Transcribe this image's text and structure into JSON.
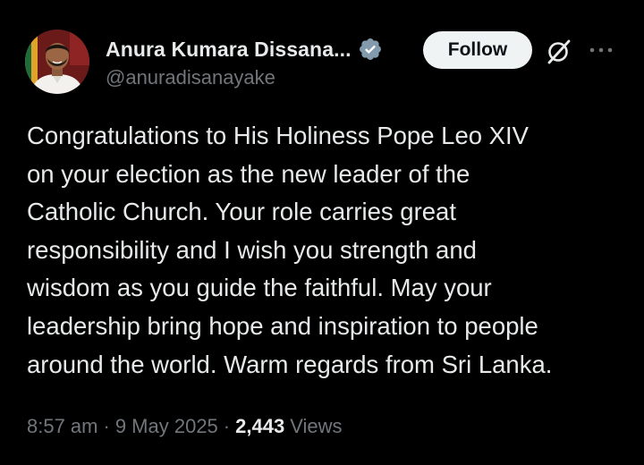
{
  "author": {
    "display_name": "Anura Kumara Dissana...",
    "handle": "@anuradisanayake",
    "verified": true,
    "avatar_icon": "profile-photo"
  },
  "actions": {
    "follow_label": "Follow",
    "grok_icon": "grok-icon",
    "more_icon": "more-dots-icon"
  },
  "tweet": {
    "text": "Congratulations to His Holiness Pope Leo XIV\non your election as the new leader of the\nCatholic Church. Your role carries great\nresponsibility and I wish you strength and\nwisdom as you guide the faithful. May your\nleadership bring hope and inspiration to people\naround the world. Warm regards from Sri Lanka.",
    "time": "8:57 am",
    "date": "9 May 2025",
    "separator": "·",
    "views_count": "2,443",
    "views_label": "Views"
  },
  "colors": {
    "background": "#000000",
    "text_primary": "#e7e9ea",
    "text_secondary": "#71767b",
    "verified_badge": "#829aab",
    "follow_bg": "#eff3f4"
  }
}
